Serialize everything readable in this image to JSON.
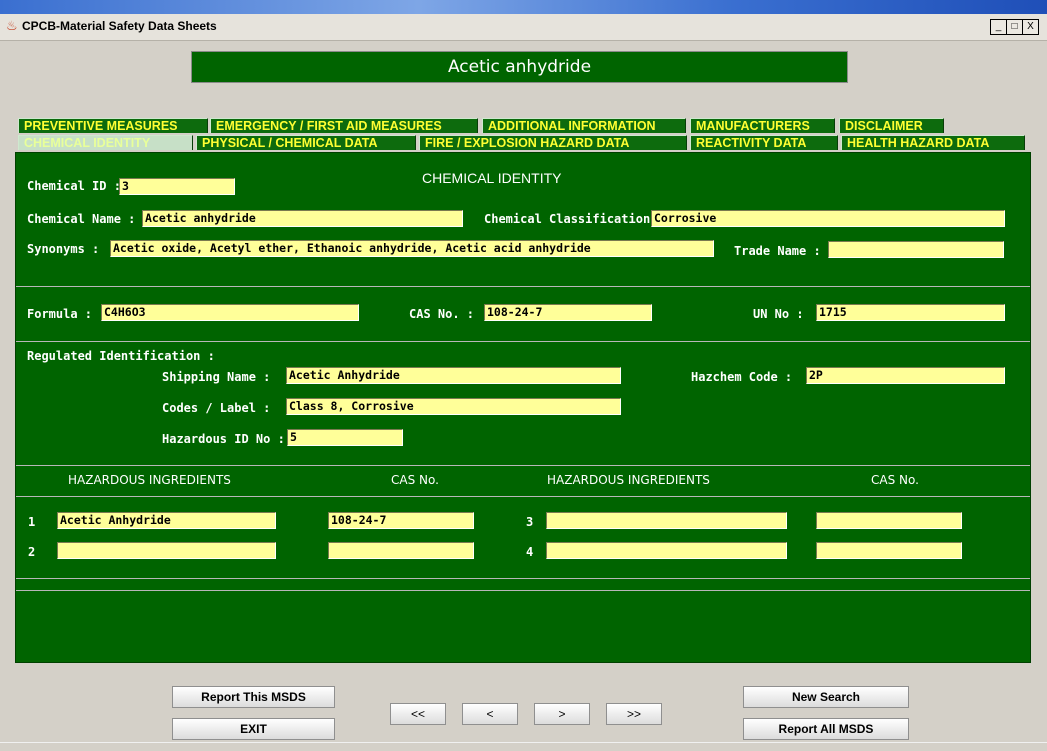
{
  "window": {
    "title": "CPCB-Material Safety Data Sheets",
    "controls": [
      "_",
      "□",
      "X"
    ]
  },
  "banner": {
    "text": "Acetic anhydride"
  },
  "tabs_row1": [
    "PREVENTIVE MEASURES",
    "EMERGENCY / FIRST AID MEASURES",
    "ADDITIONAL INFORMATION",
    "MANUFACTURERS",
    "DISCLAIMER"
  ],
  "tabs_row2": [
    "CHEMICAL IDENTITY",
    "PHYSICAL / CHEMICAL DATA",
    "FIRE / EXPLOSION HAZARD DATA",
    "REACTIVITY DATA",
    "HEALTH HAZARD DATA"
  ],
  "active_tab": "CHEMICAL IDENTITY",
  "section_title": "CHEMICAL IDENTITY",
  "identity": {
    "chemical_id_label": "Chemical ID :",
    "chemical_id": "3",
    "chemical_name_label": "Chemical Name :",
    "chemical_name": "Acetic anhydride",
    "classification_label": "Chemical Classification :",
    "classification": "Corrosive",
    "synonyms_label": "Synonyms :",
    "synonyms": "Acetic oxide, Acetyl ether, Ethanoic anhydride, Acetic acid anhydride",
    "trade_name_label": "Trade Name :",
    "trade_name": ""
  },
  "formula_row": {
    "formula_label": "Formula :",
    "formula": "C4H6O3",
    "cas_label": "CAS No. :",
    "cas": "108-24-7",
    "un_label": "UN No :",
    "un": "1715"
  },
  "regulated": {
    "heading": "Regulated Identification :",
    "shipping_label": "Shipping Name :",
    "shipping": "Acetic Anhydride",
    "hazchem_label": "Hazchem Code :",
    "hazchem": "2P",
    "codes_label": "Codes / Label :",
    "codes": "Class 8, Corrosive",
    "hazid_label": "Hazardous ID No :",
    "hazid": "5"
  },
  "ingredients": {
    "header_ing": "HAZARDOUS INGREDIENTS",
    "header_cas": "CAS No.",
    "rows": [
      {
        "n": "1",
        "name": "Acetic Anhydride",
        "cas": "108-24-7"
      },
      {
        "n": "2",
        "name": "",
        "cas": ""
      },
      {
        "n": "3",
        "name": "",
        "cas": ""
      },
      {
        "n": "4",
        "name": "",
        "cas": ""
      }
    ]
  },
  "buttons": {
    "report_this": "Report This MSDS",
    "exit": "EXIT",
    "first": "<<",
    "prev": "<",
    "next": ">",
    "last": ">>",
    "new_search": "New Search",
    "report_all": "Report All MSDS"
  },
  "colors": {
    "panel_bg": "#006400",
    "tab_text": "#ffff33",
    "field_bg": "#ffff99",
    "window_bg": "#d4d0c8"
  }
}
